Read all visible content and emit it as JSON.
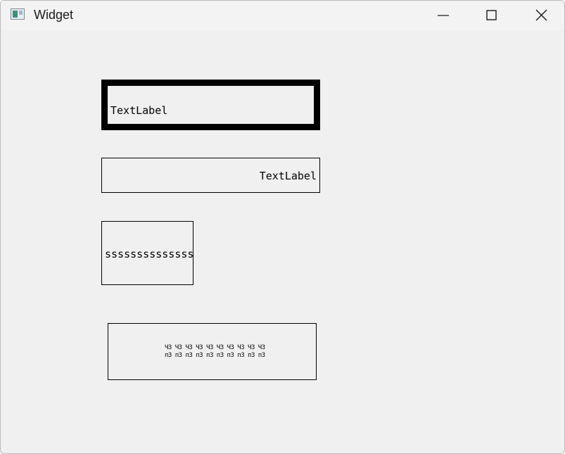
{
  "window": {
    "title": "Widget",
    "icons": {
      "app": "app-window-icon",
      "minimize": "minimize-icon",
      "maximize": "maximize-icon",
      "close": "close-icon"
    }
  },
  "labels": [
    {
      "text": "TextLabel",
      "border": "thick"
    },
    {
      "text": "TextLabel",
      "align": "right"
    },
    {
      "text": "ssssssssssssss"
    },
    {
      "lines": [
        "ЧЗ ЧЗ ЧЗ ЧЗ ЧЗ ЧЗ ЧЗ ЧЗ ЧЗ ЧЗ",
        "пЗ пЗ пЗ пЗ пЗ пЗ пЗ пЗ пЗ пЗ"
      ]
    }
  ]
}
